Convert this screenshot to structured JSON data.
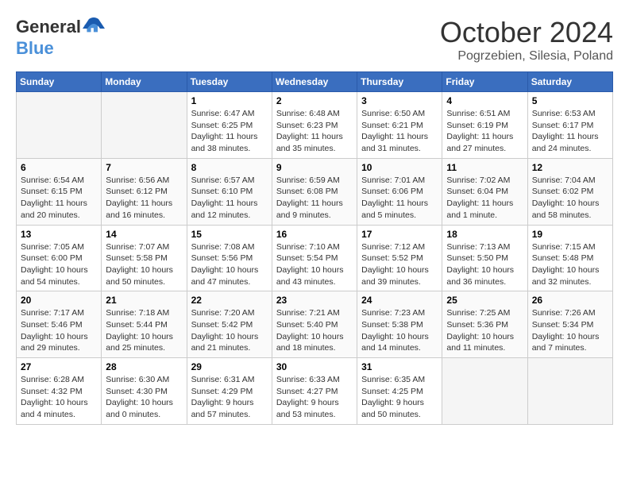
{
  "header": {
    "logo_general": "General",
    "logo_blue": "Blue",
    "month": "October 2024",
    "location": "Pogrzebien, Silesia, Poland"
  },
  "days_of_week": [
    "Sunday",
    "Monday",
    "Tuesday",
    "Wednesday",
    "Thursday",
    "Friday",
    "Saturday"
  ],
  "weeks": [
    [
      {
        "day": "",
        "empty": true
      },
      {
        "day": "",
        "empty": true
      },
      {
        "day": "1",
        "sunrise": "6:47 AM",
        "sunset": "6:25 PM",
        "daylight": "11 hours and 38 minutes."
      },
      {
        "day": "2",
        "sunrise": "6:48 AM",
        "sunset": "6:23 PM",
        "daylight": "11 hours and 35 minutes."
      },
      {
        "day": "3",
        "sunrise": "6:50 AM",
        "sunset": "6:21 PM",
        "daylight": "11 hours and 31 minutes."
      },
      {
        "day": "4",
        "sunrise": "6:51 AM",
        "sunset": "6:19 PM",
        "daylight": "11 hours and 27 minutes."
      },
      {
        "day": "5",
        "sunrise": "6:53 AM",
        "sunset": "6:17 PM",
        "daylight": "11 hours and 24 minutes."
      }
    ],
    [
      {
        "day": "6",
        "sunrise": "6:54 AM",
        "sunset": "6:15 PM",
        "daylight": "11 hours and 20 minutes."
      },
      {
        "day": "7",
        "sunrise": "6:56 AM",
        "sunset": "6:12 PM",
        "daylight": "11 hours and 16 minutes."
      },
      {
        "day": "8",
        "sunrise": "6:57 AM",
        "sunset": "6:10 PM",
        "daylight": "11 hours and 12 minutes."
      },
      {
        "day": "9",
        "sunrise": "6:59 AM",
        "sunset": "6:08 PM",
        "daylight": "11 hours and 9 minutes."
      },
      {
        "day": "10",
        "sunrise": "7:01 AM",
        "sunset": "6:06 PM",
        "daylight": "11 hours and 5 minutes."
      },
      {
        "day": "11",
        "sunrise": "7:02 AM",
        "sunset": "6:04 PM",
        "daylight": "11 hours and 1 minute."
      },
      {
        "day": "12",
        "sunrise": "7:04 AM",
        "sunset": "6:02 PM",
        "daylight": "10 hours and 58 minutes."
      }
    ],
    [
      {
        "day": "13",
        "sunrise": "7:05 AM",
        "sunset": "6:00 PM",
        "daylight": "10 hours and 54 minutes."
      },
      {
        "day": "14",
        "sunrise": "7:07 AM",
        "sunset": "5:58 PM",
        "daylight": "10 hours and 50 minutes."
      },
      {
        "day": "15",
        "sunrise": "7:08 AM",
        "sunset": "5:56 PM",
        "daylight": "10 hours and 47 minutes."
      },
      {
        "day": "16",
        "sunrise": "7:10 AM",
        "sunset": "5:54 PM",
        "daylight": "10 hours and 43 minutes."
      },
      {
        "day": "17",
        "sunrise": "7:12 AM",
        "sunset": "5:52 PM",
        "daylight": "10 hours and 39 minutes."
      },
      {
        "day": "18",
        "sunrise": "7:13 AM",
        "sunset": "5:50 PM",
        "daylight": "10 hours and 36 minutes."
      },
      {
        "day": "19",
        "sunrise": "7:15 AM",
        "sunset": "5:48 PM",
        "daylight": "10 hours and 32 minutes."
      }
    ],
    [
      {
        "day": "20",
        "sunrise": "7:17 AM",
        "sunset": "5:46 PM",
        "daylight": "10 hours and 29 minutes."
      },
      {
        "day": "21",
        "sunrise": "7:18 AM",
        "sunset": "5:44 PM",
        "daylight": "10 hours and 25 minutes."
      },
      {
        "day": "22",
        "sunrise": "7:20 AM",
        "sunset": "5:42 PM",
        "daylight": "10 hours and 21 minutes."
      },
      {
        "day": "23",
        "sunrise": "7:21 AM",
        "sunset": "5:40 PM",
        "daylight": "10 hours and 18 minutes."
      },
      {
        "day": "24",
        "sunrise": "7:23 AM",
        "sunset": "5:38 PM",
        "daylight": "10 hours and 14 minutes."
      },
      {
        "day": "25",
        "sunrise": "7:25 AM",
        "sunset": "5:36 PM",
        "daylight": "10 hours and 11 minutes."
      },
      {
        "day": "26",
        "sunrise": "7:26 AM",
        "sunset": "5:34 PM",
        "daylight": "10 hours and 7 minutes."
      }
    ],
    [
      {
        "day": "27",
        "sunrise": "6:28 AM",
        "sunset": "4:32 PM",
        "daylight": "10 hours and 4 minutes."
      },
      {
        "day": "28",
        "sunrise": "6:30 AM",
        "sunset": "4:30 PM",
        "daylight": "10 hours and 0 minutes."
      },
      {
        "day": "29",
        "sunrise": "6:31 AM",
        "sunset": "4:29 PM",
        "daylight": "9 hours and 57 minutes."
      },
      {
        "day": "30",
        "sunrise": "6:33 AM",
        "sunset": "4:27 PM",
        "daylight": "9 hours and 53 minutes."
      },
      {
        "day": "31",
        "sunrise": "6:35 AM",
        "sunset": "4:25 PM",
        "daylight": "9 hours and 50 minutes."
      },
      {
        "day": "",
        "empty": true
      },
      {
        "day": "",
        "empty": true
      }
    ]
  ]
}
